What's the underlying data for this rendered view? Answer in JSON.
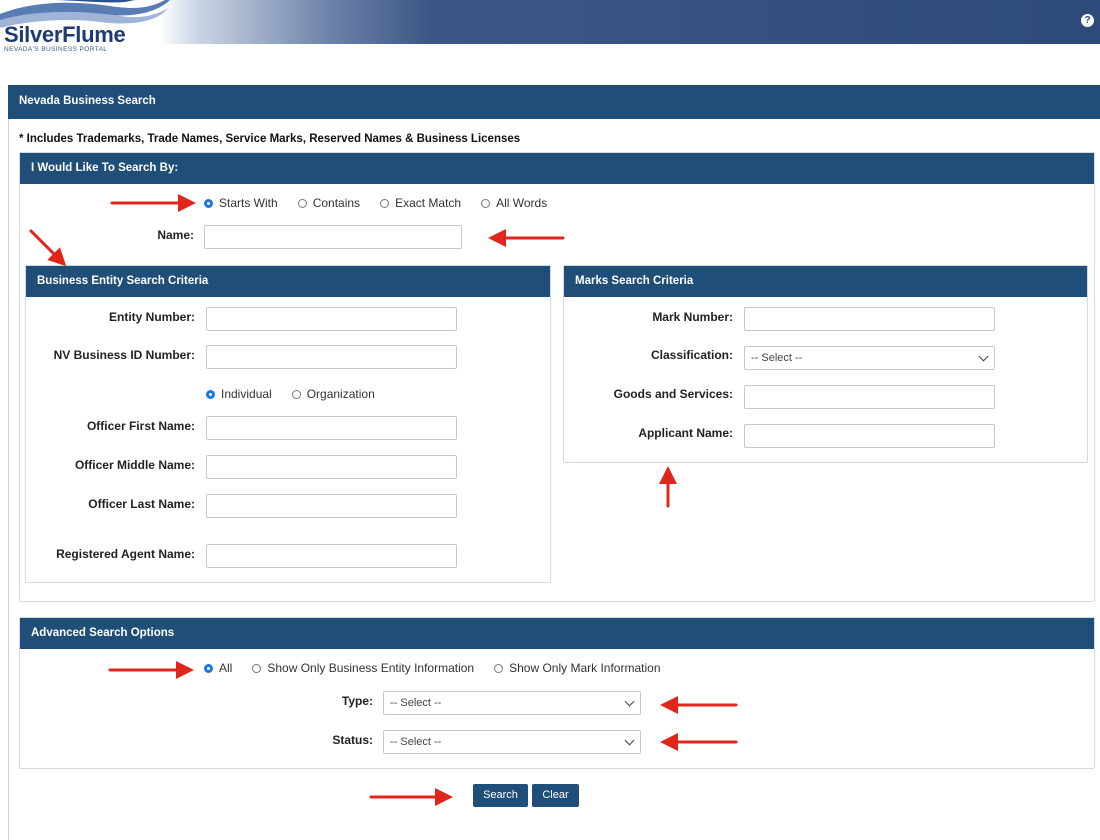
{
  "header": {
    "logo_text": "SilverFlume",
    "logo_tagline": "NEVADA'S BUSINESS PORTAL",
    "help_icon": "question-circle-icon"
  },
  "main": {
    "title": "Nevada Business Search",
    "note": "* Includes Trademarks, Trade Names, Service Marks, Reserved Names & Business Licenses"
  },
  "search_by": {
    "title": "I Would Like To Search By:",
    "options": [
      "Starts With",
      "Contains",
      "Exact Match",
      "All Words"
    ],
    "selected": "Starts With",
    "name_label": "Name:",
    "name_value": ""
  },
  "entity": {
    "title": "Business Entity Search Criteria",
    "entity_number_label": "Entity Number:",
    "nv_id_label": "NV Business ID Number:",
    "officer_type_options": [
      "Individual",
      "Organization"
    ],
    "officer_type_selected": "Individual",
    "first_name_label": "Officer First Name:",
    "middle_name_label": "Officer Middle Name:",
    "last_name_label": "Officer Last Name:",
    "agent_label": "Registered Agent Name:"
  },
  "marks": {
    "title": "Marks Search Criteria",
    "mark_number_label": "Mark Number:",
    "classification_label": "Classification:",
    "classification_value": "-- Select --",
    "goods_label": "Goods and Services:",
    "applicant_label": "Applicant Name:"
  },
  "advanced": {
    "title": "Advanced Search Options",
    "options": [
      "All",
      "Show Only Business Entity Information",
      "Show Only Mark Information"
    ],
    "selected": "All",
    "type_label": "Type:",
    "type_value": "-- Select --",
    "status_label": "Status:",
    "status_value": "-- Select --"
  },
  "buttons": {
    "search": "Search",
    "clear": "Clear"
  },
  "colors": {
    "header_blue": "#1f4e79",
    "radio_selected": "#1a73e8",
    "annotation_arrow": "#e0261b"
  }
}
